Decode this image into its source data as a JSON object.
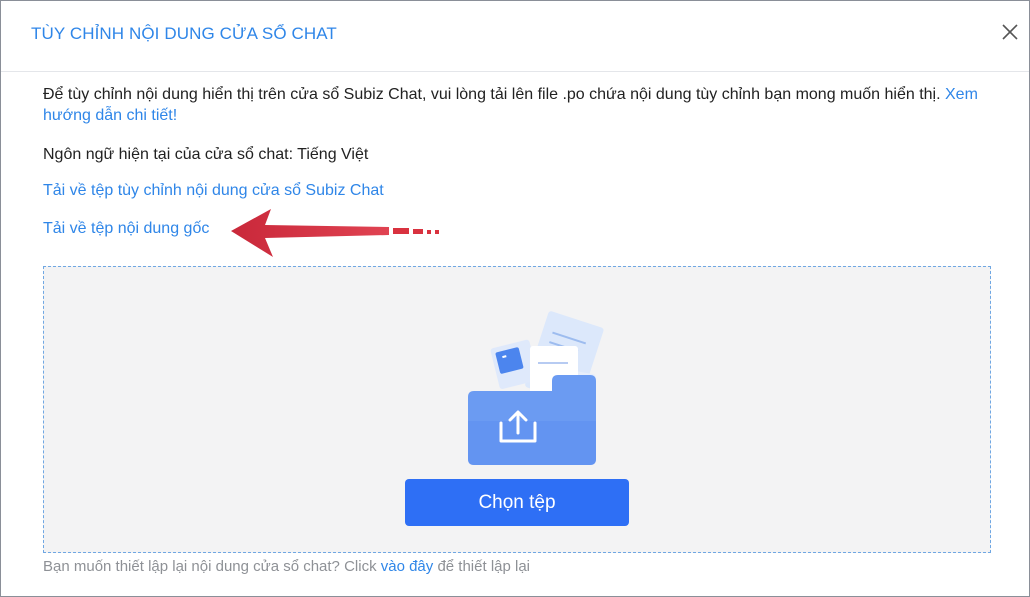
{
  "dialog": {
    "title": "TÙY CHỈNH NỘI DUNG CỬA SỔ CHAT",
    "close_icon": "close-icon"
  },
  "content": {
    "intro_text": "Để tùy chỉnh nội dung hiển thị trên cửa sổ Subiz Chat, vui lòng tải lên file .po chứa nội dung tùy chỉnh bạn mong muốn hiển thị.",
    "guide_link": "Xem hướng dẫn chi tiết!",
    "current_language": "Ngôn ngữ hiện tại của cửa sổ chat: Tiếng Việt",
    "download_custom_link": "Tải về tệp tùy chỉnh nội dung cửa sổ Subiz Chat",
    "download_original_link": "Tải về tệp nội dung gốc"
  },
  "annotation": {
    "arrow_icon": "red-arrow-icon",
    "color": "#d9323f"
  },
  "dropzone": {
    "illustration": "folder-upload-icon",
    "choose_button": "Chọn tệp"
  },
  "footer": {
    "text_before": "Bạn muốn thiết lập lại nội dung cửa sổ chat? Click ",
    "link": "vào đây",
    "text_after": " để thiết lập lại"
  },
  "colors": {
    "accent": "#2f86e8",
    "button": "#2e6ff5",
    "dropzone_bg": "#f3f3f4"
  }
}
